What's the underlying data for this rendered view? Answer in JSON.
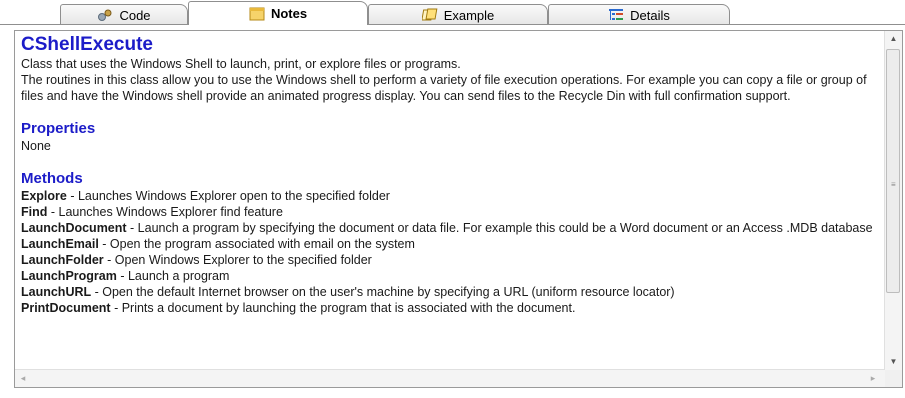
{
  "tabs": [
    {
      "label": "Code",
      "icon": "code-icon"
    },
    {
      "label": "Notes",
      "icon": "notes-icon",
      "active": true
    },
    {
      "label": "Example",
      "icon": "example-icon"
    },
    {
      "label": "Details",
      "icon": "details-icon"
    }
  ],
  "doc": {
    "title": "CShellExecute",
    "summary": "Class that uses the Windows Shell to launch, print, or explore files or programs.",
    "description": "The routines in this class allow you to use the Windows shell to perform a variety of file execution operations. For example you can copy a file or group of files and have the Windows shell provide an animated progress display. You can send files to the Recycle Din with full confirmation support.",
    "properties_heading": "Properties",
    "properties_value": "None",
    "methods_heading": "Methods",
    "methods": [
      {
        "name": "Explore",
        "desc": " - Launches Windows Explorer open to the specified folder"
      },
      {
        "name": "Find",
        "desc": " - Launches Windows Explorer find feature"
      },
      {
        "name": "LaunchDocument",
        "desc": " - Launch a program by specifying the document or data file. For example this could be a Word document or an Access .MDB database"
      },
      {
        "name": "LaunchEmail",
        "desc": " - Open the program associated with email on the system"
      },
      {
        "name": "LaunchFolder",
        "desc": " - Open Windows Explorer to the specified folder"
      },
      {
        "name": "LaunchProgram",
        "desc": " - Launch a program"
      },
      {
        "name": "LaunchURL",
        "desc": " - Open the default Internet browser on the user's machine by specifying a URL (uniform resource locator)"
      },
      {
        "name": "PrintDocument",
        "desc": " - Prints a document by launching the program that is associated with the document."
      }
    ]
  },
  "colors": {
    "heading": "#1c1cc8",
    "border": "#8f8f8f"
  }
}
